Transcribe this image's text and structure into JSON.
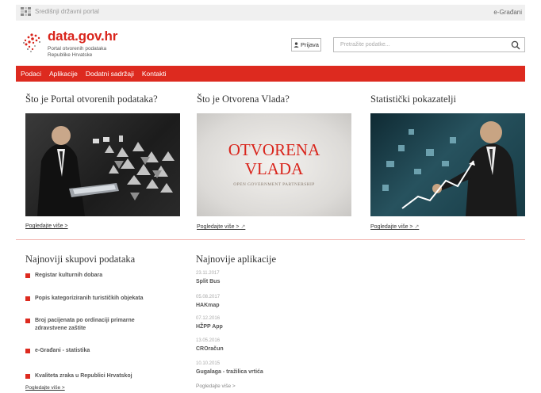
{
  "topbar": {
    "portal_label": "Središnji državni portal",
    "egradani_label": "e-Građani"
  },
  "header": {
    "logo_title": "data.gov.hr",
    "logo_sub_line1": "Portal otvorenih podataka",
    "logo_sub_line2": "Republike Hrvatske",
    "login_label": "Prijava",
    "search_placeholder": "Pretražite podatke..."
  },
  "nav": {
    "items": [
      "Podaci",
      "Aplikacije",
      "Dodatni sadržaji",
      "Kontakti"
    ]
  },
  "cards": [
    {
      "title": "Što je Portal otvorenih podataka?",
      "more": "Pogledajte više >"
    },
    {
      "title": "Što je Otvorena Vlada?",
      "more": "Pogledajte više >",
      "image_line1": "OTVORENA",
      "image_line2": "VLADA",
      "image_tagline": "OPEN GOVERNMENT PARTNERSHIP"
    },
    {
      "title": "Statistički pokazatelji",
      "more": "Pogledajte više >"
    }
  ],
  "datasets": {
    "title": "Najnoviji skupovi podataka",
    "items": [
      "Registar kulturnih dobara",
      "Popis kategoriziranih turističkih objekata",
      "Broj pacijenata po ordinaciji primarne zdravstvene zaštite",
      "e-Građani - statistika",
      "Kvaliteta zraka u Republici Hrvatskoj"
    ],
    "more": "Pogledajte više >"
  },
  "apps": {
    "title": "Najnovije aplikacije",
    "items": [
      {
        "date": "23.11.2017",
        "name": "Split Bus"
      },
      {
        "date": "05.08.2017",
        "name": "HAKmap"
      },
      {
        "date": "07.12.2016",
        "name": "HŽPP App"
      },
      {
        "date": "13.05.2016",
        "name": "CROračun"
      },
      {
        "date": "10.10.2015",
        "name": "Gugalaga - tražilica vrtića"
      }
    ],
    "more": "Pogledajte više >"
  },
  "colors": {
    "brand_red": "#dd2a1f",
    "topbar_bg": "#f0f0f0"
  }
}
